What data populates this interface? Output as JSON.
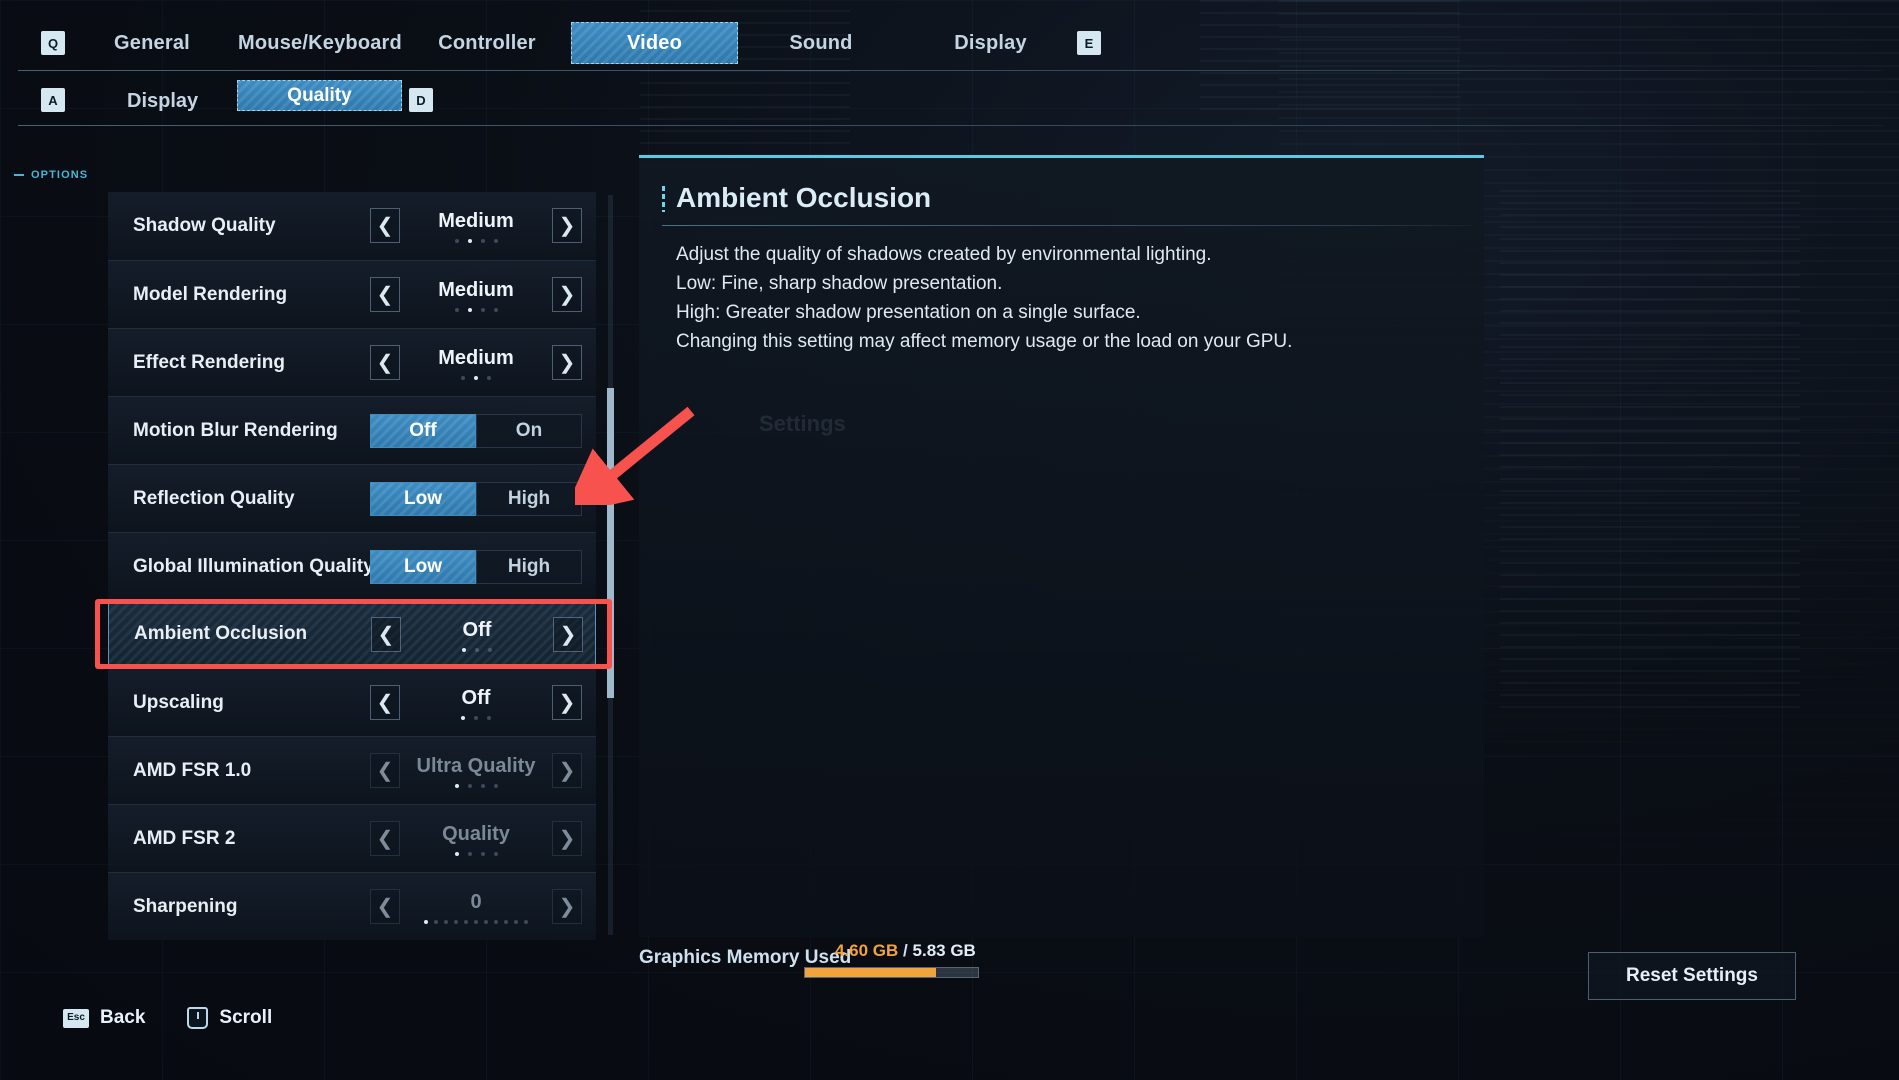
{
  "topnav": {
    "left_key": "Q",
    "right_key": "E",
    "tabs": [
      {
        "label": "General",
        "active": false
      },
      {
        "label": "Mouse/Keyboard",
        "active": false
      },
      {
        "label": "Controller",
        "active": false
      },
      {
        "label": "Video",
        "active": true
      },
      {
        "label": "Sound",
        "active": false
      },
      {
        "label": "Display",
        "active": false
      }
    ]
  },
  "subnav": {
    "left_key": "A",
    "right_key": "D",
    "label": "Display",
    "selected": "Quality"
  },
  "options_header": "OPTIONS",
  "settings": [
    {
      "name": "Shadow Quality",
      "type": "stepper",
      "value": "Medium",
      "dots": 4,
      "active_dot": 2,
      "enabled": true,
      "selected": false
    },
    {
      "name": "Model Rendering",
      "type": "stepper",
      "value": "Medium",
      "dots": 4,
      "active_dot": 2,
      "enabled": true,
      "selected": false
    },
    {
      "name": "Effect Rendering",
      "type": "stepper",
      "value": "Medium",
      "dots": 3,
      "active_dot": 2,
      "enabled": true,
      "selected": false
    },
    {
      "name": "Motion Blur Rendering",
      "type": "toggle",
      "options": [
        "Off",
        "On"
      ],
      "value": "Off",
      "enabled": true,
      "selected": false
    },
    {
      "name": "Reflection Quality",
      "type": "toggle",
      "options": [
        "Low",
        "High"
      ],
      "value": "Low",
      "enabled": true,
      "selected": false
    },
    {
      "name": "Global Illumination Quality",
      "type": "toggle",
      "options": [
        "Low",
        "High"
      ],
      "value": "Low",
      "enabled": true,
      "selected": false
    },
    {
      "name": "Ambient Occlusion",
      "type": "stepper",
      "value": "Off",
      "dots": 3,
      "active_dot": 1,
      "enabled": true,
      "selected": true
    },
    {
      "name": "Upscaling",
      "type": "stepper",
      "value": "Off",
      "dots": 3,
      "active_dot": 1,
      "enabled": true,
      "selected": false
    },
    {
      "name": "AMD FSR 1.0",
      "type": "stepper",
      "value": "Ultra Quality",
      "dots": 4,
      "active_dot": 1,
      "enabled": false,
      "selected": false
    },
    {
      "name": "AMD FSR 2",
      "type": "stepper",
      "value": "Quality",
      "dots": 4,
      "active_dot": 1,
      "enabled": false,
      "selected": false
    },
    {
      "name": "Sharpening",
      "type": "stepper",
      "value": "0",
      "dots": 11,
      "active_dot": 1,
      "enabled": false,
      "selected": false
    }
  ],
  "detail": {
    "title": "Ambient Occlusion",
    "lines": [
      "Adjust the quality of shadows created by environmental lighting.",
      "Low: Fine, sharp shadow presentation.",
      "High: Greater shadow presentation on a single surface.",
      "Changing this setting may affect memory usage or the load on your GPU."
    ],
    "watermark": "Settings"
  },
  "memory": {
    "label": "Graphics Memory Used",
    "used": "4.60 GB",
    "separator": "/",
    "total": "5.83 GB",
    "fill_percent": 76
  },
  "reset_button": "Reset Settings",
  "hints": [
    {
      "key": "Esc",
      "label": "Back"
    },
    {
      "key": "scroll-wheel-icon",
      "label": "Scroll"
    }
  ],
  "colors": {
    "accent_blue": "#3d8cc2",
    "accent_cyan": "#5fc8e4",
    "annotation_red": "#f8524f",
    "memory_orange": "#f2a33c"
  }
}
